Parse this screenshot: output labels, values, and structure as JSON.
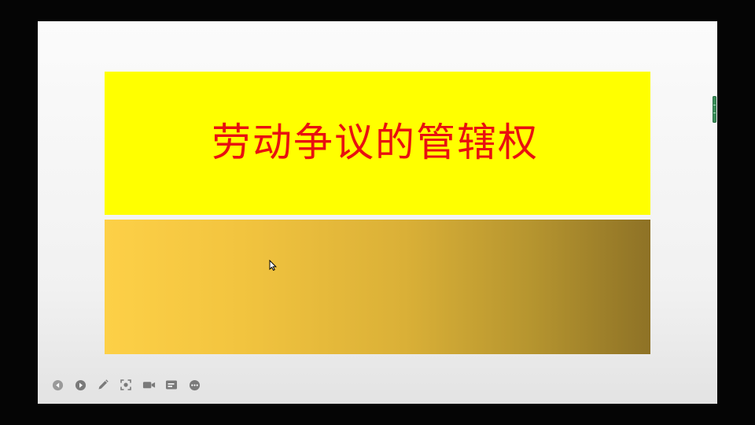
{
  "slide": {
    "title": "劳动争议的管辖权"
  },
  "toolbar": {
    "buttons": [
      {
        "name": "previous-slide-icon"
      },
      {
        "name": "next-slide-icon"
      },
      {
        "name": "pen-icon"
      },
      {
        "name": "focus-icon"
      },
      {
        "name": "camera-icon"
      },
      {
        "name": "subtitle-icon"
      },
      {
        "name": "more-icon"
      }
    ]
  },
  "colors": {
    "title_band": "#ffff00",
    "title_text": "#e81010",
    "gold_start": "#fdd047",
    "gold_end": "#8e7226",
    "toolbar_icon": "#808080",
    "side_handle": "#3b8f5a"
  }
}
